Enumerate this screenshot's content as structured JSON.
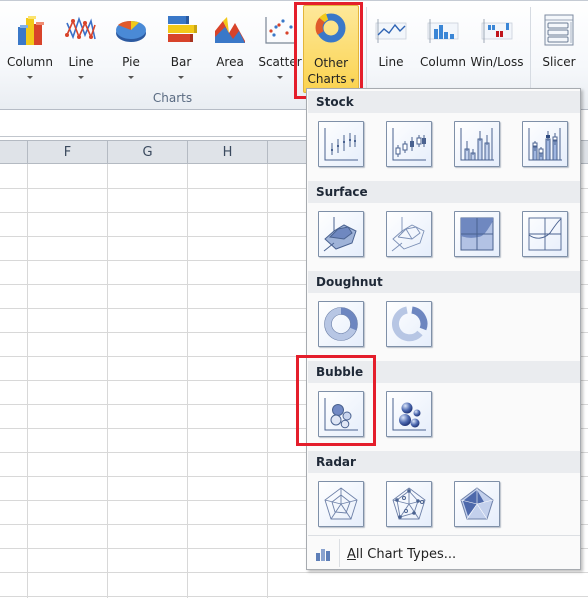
{
  "ribbon": {
    "group_label": "Charts",
    "buttons": [
      {
        "label": "Column",
        "icon": "column-chart-icon",
        "has_dropdown": true
      },
      {
        "label": "Line",
        "icon": "line-chart-icon",
        "has_dropdown": true
      },
      {
        "label": "Pie",
        "icon": "pie-chart-icon",
        "has_dropdown": true
      },
      {
        "label": "Bar",
        "icon": "bar-chart-icon",
        "has_dropdown": true
      },
      {
        "label": "Area",
        "icon": "area-chart-icon",
        "has_dropdown": true
      },
      {
        "label": "Scatter",
        "icon": "scatter-chart-icon",
        "has_dropdown": true
      }
    ],
    "other_charts": {
      "label_line1": "Other",
      "label_line2": "Charts",
      "icon": "doughnut-chart-icon",
      "active": true
    },
    "sparklines": [
      {
        "label": "Line",
        "icon": "sparkline-line-icon"
      },
      {
        "label": "Column",
        "icon": "sparkline-column-icon"
      },
      {
        "label": "Win/Loss",
        "icon": "sparkline-winloss-icon"
      }
    ],
    "slicer": {
      "label": "Slicer",
      "icon": "slicer-icon"
    }
  },
  "sheet": {
    "columns": [
      "F",
      "G",
      "H",
      ""
    ]
  },
  "dropdown": {
    "sections": [
      {
        "title": "Stock",
        "items": [
          "High-Low-Close",
          "Open-High-Low-Close",
          "Volume-High-Low-Close",
          "Volume-Open-High-Low-Close"
        ]
      },
      {
        "title": "Surface",
        "items": [
          "3-D Surface",
          "Wireframe 3-D Surface",
          "Contour",
          "Wireframe Contour"
        ]
      },
      {
        "title": "Doughnut",
        "items": [
          "Doughnut",
          "Exploded Doughnut"
        ]
      },
      {
        "title": "Bubble",
        "items": [
          "Bubble",
          "Bubble with a 3-D Effect"
        ],
        "highlighted": true
      },
      {
        "title": "Radar",
        "items": [
          "Radar",
          "Radar with Markers",
          "Filled Radar"
        ]
      }
    ],
    "all_chart_types": {
      "label": "All Chart Types...",
      "accelerator": "A"
    }
  },
  "colors": {
    "highlight": "#e41e2b",
    "active_button": "#fbd34f",
    "tile_stroke": "#4a6290"
  }
}
